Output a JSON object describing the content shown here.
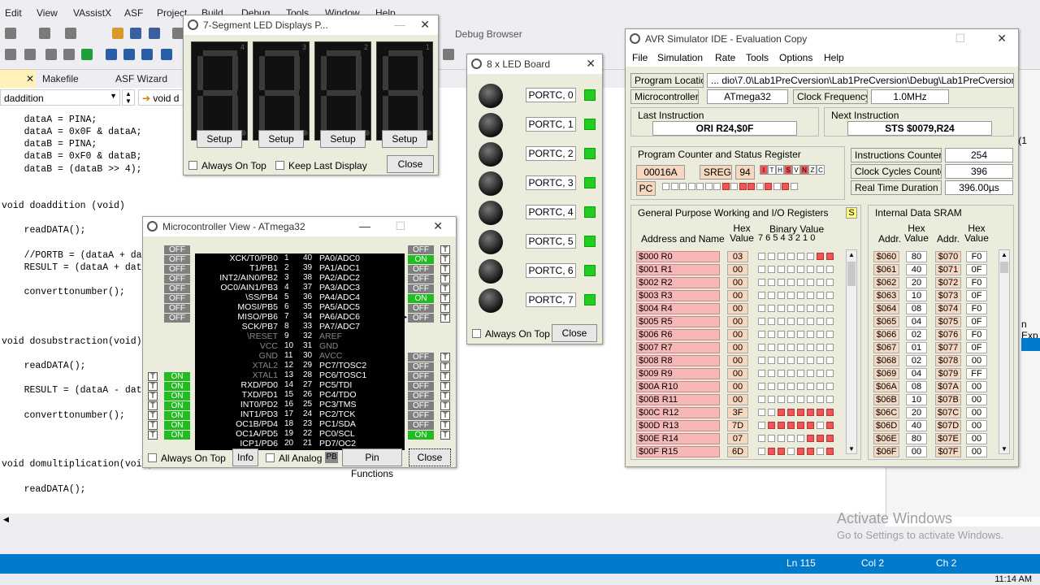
{
  "vs": {
    "menu": [
      "Edit",
      "View",
      "VAssistX",
      "ASF",
      "Project",
      "Build",
      "Debug",
      "Tools",
      "Window",
      "Help"
    ],
    "debug_target": "Debug Browser",
    "tabs": [
      "Makefile",
      "ASF Wizard"
    ],
    "function_combo": "daddition",
    "function_combo2": "void d",
    "code": [
      "    dataA = PINA;",
      "    dataA = 0x0F & dataA;",
      "    dataB = PINA;",
      "    dataB = 0xF0 & dataB;",
      "    dataB = (dataB >> 4);",
      "",
      "",
      "void doaddition (void)",
      "",
      "    readDATA();",
      "",
      "    //PORTB = (dataA + dataB",
      "    RESULT = (dataA + dataB)",
      "",
      "    converttonumber();",
      "",
      "",
      "",
      "void dosubstraction(void)",
      "",
      "    readDATA();",
      "",
      "    RESULT = (dataA - dataB)",
      "",
      "    converttonumber();",
      "",
      "",
      "",
      "void domultiplication(void)",
      "",
      "    readDATA();"
    ],
    "right_snippets": [
      "n' (1",
      "n Exp"
    ],
    "status": {
      "ln": "Ln 115",
      "col": "Col 2",
      "ch": "Ch 2"
    },
    "clock": "11:14 AM",
    "watermark_title": "Activate Windows",
    "watermark_sub": "Go to Settings to activate Windows."
  },
  "seg7": {
    "title": "7-Segment LED Displays P...",
    "digit_labels": [
      "4",
      "3",
      "2",
      "1"
    ],
    "setup_label": "Setup",
    "always_on_top": "Always On Top",
    "keep_last": "Keep Last Display",
    "close": "Close"
  },
  "ledboard": {
    "title": "8 x LED Board",
    "leds": [
      "PORTC, 0",
      "PORTC, 1",
      "PORTC, 2",
      "PORTC, 3",
      "PORTC, 4",
      "PORTC, 5",
      "PORTC, 6",
      "PORTC, 7"
    ],
    "always_on_top": "Always On Top",
    "close": "Close",
    "led_color": "#22cc22"
  },
  "mcu": {
    "title": "Microcontroller View - ATmega32",
    "left_pins": [
      {
        "n": "1",
        "name": "XCK/T0/PB0",
        "state": "OFF"
      },
      {
        "n": "2",
        "name": "T1/PB1",
        "state": "OFF"
      },
      {
        "n": "3",
        "name": "INT2/AIN0/PB2",
        "state": "OFF"
      },
      {
        "n": "4",
        "name": "OC0/AIN1/PB3",
        "state": "OFF"
      },
      {
        "n": "5",
        "name": "\\SS/PB4",
        "state": "OFF"
      },
      {
        "n": "6",
        "name": "MOSI/PB5",
        "state": "OFF"
      },
      {
        "n": "7",
        "name": "MISO/PB6",
        "state": "OFF"
      },
      {
        "n": "8",
        "name": "SCK/PB7",
        "state": "OFF"
      },
      {
        "n": "9",
        "name": "\\RESET",
        "state": ""
      },
      {
        "n": "10",
        "name": "VCC",
        "state": ""
      },
      {
        "n": "11",
        "name": "GND",
        "state": ""
      },
      {
        "n": "12",
        "name": "XTAL2",
        "state": ""
      },
      {
        "n": "13",
        "name": "XTAL1",
        "state": ""
      },
      {
        "n": "14",
        "name": "RXD/PD0",
        "state": "ON"
      },
      {
        "n": "15",
        "name": "TXD/PD1",
        "state": "ON"
      },
      {
        "n": "16",
        "name": "INT0/PD2",
        "state": "ON"
      },
      {
        "n": "17",
        "name": "INT1/PD3",
        "state": "ON"
      },
      {
        "n": "18",
        "name": "OC1B/PD4",
        "state": "ON"
      },
      {
        "n": "19",
        "name": "OC1A/PD5",
        "state": "ON"
      },
      {
        "n": "20",
        "name": "ICP1/PD6",
        "state": "ON"
      }
    ],
    "right_pins": [
      {
        "n": "40",
        "name": "PA0/ADC0",
        "state": "OFF"
      },
      {
        "n": "39",
        "name": "PA1/ADC1",
        "state": "ON"
      },
      {
        "n": "38",
        "name": "PA2/ADC2",
        "state": "OFF"
      },
      {
        "n": "37",
        "name": "PA3/ADC3",
        "state": "OFF"
      },
      {
        "n": "36",
        "name": "PA4/ADC4",
        "state": "OFF"
      },
      {
        "n": "35",
        "name": "PA5/ADC5",
        "state": "ON"
      },
      {
        "n": "34",
        "name": "PA6/ADC6",
        "state": "OFF"
      },
      {
        "n": "33",
        "name": "PA7/ADC7",
        "state": "OFF"
      },
      {
        "n": "32",
        "name": "AREF",
        "state": ""
      },
      {
        "n": "31",
        "name": "GND",
        "state": ""
      },
      {
        "n": "30",
        "name": "AVCC",
        "state": ""
      },
      {
        "n": "29",
        "name": "PC7/TOSC2",
        "state": "OFF"
      },
      {
        "n": "28",
        "name": "PC6/TOSC1",
        "state": "OFF"
      },
      {
        "n": "27",
        "name": "PC5/TDI",
        "state": "OFF"
      },
      {
        "n": "26",
        "name": "PC4/TDO",
        "state": "OFF"
      },
      {
        "n": "25",
        "name": "PC3/TMS",
        "state": "OFF"
      },
      {
        "n": "24",
        "name": "PC2/TCK",
        "state": "OFF"
      },
      {
        "n": "23",
        "name": "PC1/SDA",
        "state": "OFF"
      },
      {
        "n": "22",
        "name": "PC0/SCL",
        "state": "OFF"
      },
      {
        "n": "21",
        "name": "PD7/OC2",
        "state": "ON"
      }
    ],
    "t_label": "T",
    "always_on_top": "Always On Top",
    "info": "Info",
    "all_analog": "All Analog",
    "pb": "PB",
    "pin_functions": "Pin Functions",
    "close": "Close"
  },
  "avr": {
    "title": "AVR Simulator IDE - Evaluation Copy",
    "menu": [
      "File",
      "Simulation",
      "Rate",
      "Tools",
      "Options",
      "Help"
    ],
    "program_location_label": "Program Location",
    "program_location": "... dio\\7.0\\Lab1PreCversion\\Lab1PreCversion\\Debug\\Lab1PreCversion.hex",
    "microcontroller_label": "Microcontroller",
    "microcontroller": "ATmega32",
    "clock_label": "Clock Frequency",
    "clock": "1.0MHz",
    "last_instr_label": "Last Instruction",
    "last_instr": "ORI R24,$0F",
    "next_instr_label": "Next Instruction",
    "next_instr": "STS $0079,R24",
    "pcsr_label": "Program Counter and Status Register",
    "pc_value": "00016A",
    "sreg_label": "SREG",
    "sreg_value": "94",
    "sreg_bits": [
      "I",
      "T",
      "H",
      "S",
      "V",
      "N",
      "Z",
      "C"
    ],
    "pc_label": "PC",
    "instr_counter_label": "Instructions Counter",
    "instr_counter": "254",
    "cycles_label": "Clock Cycles Counter",
    "cycles": "396",
    "realtime_label": "Real Time Duration",
    "realtime": "396.00µs",
    "gp_label": "General Purpose Working and I/O Registers",
    "gp_s": "S",
    "addr_name_hdr": "Address and Name",
    "hex_hdr": "Hex Value",
    "bin_hdr": "Binary Value",
    "bin_bits_hdr": "7 6 5 4 3 2 1 0",
    "registers": [
      {
        "name": "$000  R0",
        "hex": "03"
      },
      {
        "name": "$001  R1",
        "hex": "00"
      },
      {
        "name": "$002  R2",
        "hex": "00"
      },
      {
        "name": "$003  R3",
        "hex": "00"
      },
      {
        "name": "$004  R4",
        "hex": "00"
      },
      {
        "name": "$005  R5",
        "hex": "00"
      },
      {
        "name": "$006  R6",
        "hex": "00"
      },
      {
        "name": "$007  R7",
        "hex": "00"
      },
      {
        "name": "$008  R8",
        "hex": "00"
      },
      {
        "name": "$009  R9",
        "hex": "00"
      },
      {
        "name": "$00A  R10",
        "hex": "00"
      },
      {
        "name": "$00B  R11",
        "hex": "00"
      },
      {
        "name": "$00C  R12",
        "hex": "3F"
      },
      {
        "name": "$00D  R13",
        "hex": "7D"
      },
      {
        "name": "$00E  R14",
        "hex": "07"
      },
      {
        "name": "$00F  R15",
        "hex": "6D"
      }
    ],
    "sram_label": "Internal Data SRAM",
    "sram_addr_hdr": "Addr.",
    "sram_hex_hdr": "Hex Value",
    "sram": [
      {
        "a1": "$060",
        "v1": "80",
        "a2": "$070",
        "v2": "F0"
      },
      {
        "a1": "$061",
        "v1": "40",
        "a2": "$071",
        "v2": "0F"
      },
      {
        "a1": "$062",
        "v1": "20",
        "a2": "$072",
        "v2": "F0"
      },
      {
        "a1": "$063",
        "v1": "10",
        "a2": "$073",
        "v2": "0F"
      },
      {
        "a1": "$064",
        "v1": "08",
        "a2": "$074",
        "v2": "F0"
      },
      {
        "a1": "$065",
        "v1": "04",
        "a2": "$075",
        "v2": "0F"
      },
      {
        "a1": "$066",
        "v1": "02",
        "a2": "$076",
        "v2": "F0"
      },
      {
        "a1": "$067",
        "v1": "01",
        "a2": "$077",
        "v2": "0F"
      },
      {
        "a1": "$068",
        "v1": "02",
        "a2": "$078",
        "v2": "00"
      },
      {
        "a1": "$069",
        "v1": "04",
        "a2": "$079",
        "v2": "FF"
      },
      {
        "a1": "$06A",
        "v1": "08",
        "a2": "$07A",
        "v2": "00"
      },
      {
        "a1": "$06B",
        "v1": "10",
        "a2": "$07B",
        "v2": "00"
      },
      {
        "a1": "$06C",
        "v1": "20",
        "a2": "$07C",
        "v2": "00"
      },
      {
        "a1": "$06D",
        "v1": "40",
        "a2": "$07D",
        "v2": "00"
      },
      {
        "a1": "$06E",
        "v1": "80",
        "a2": "$07E",
        "v2": "00"
      },
      {
        "a1": "$06F",
        "v1": "00",
        "a2": "$07F",
        "v2": "00"
      }
    ]
  }
}
